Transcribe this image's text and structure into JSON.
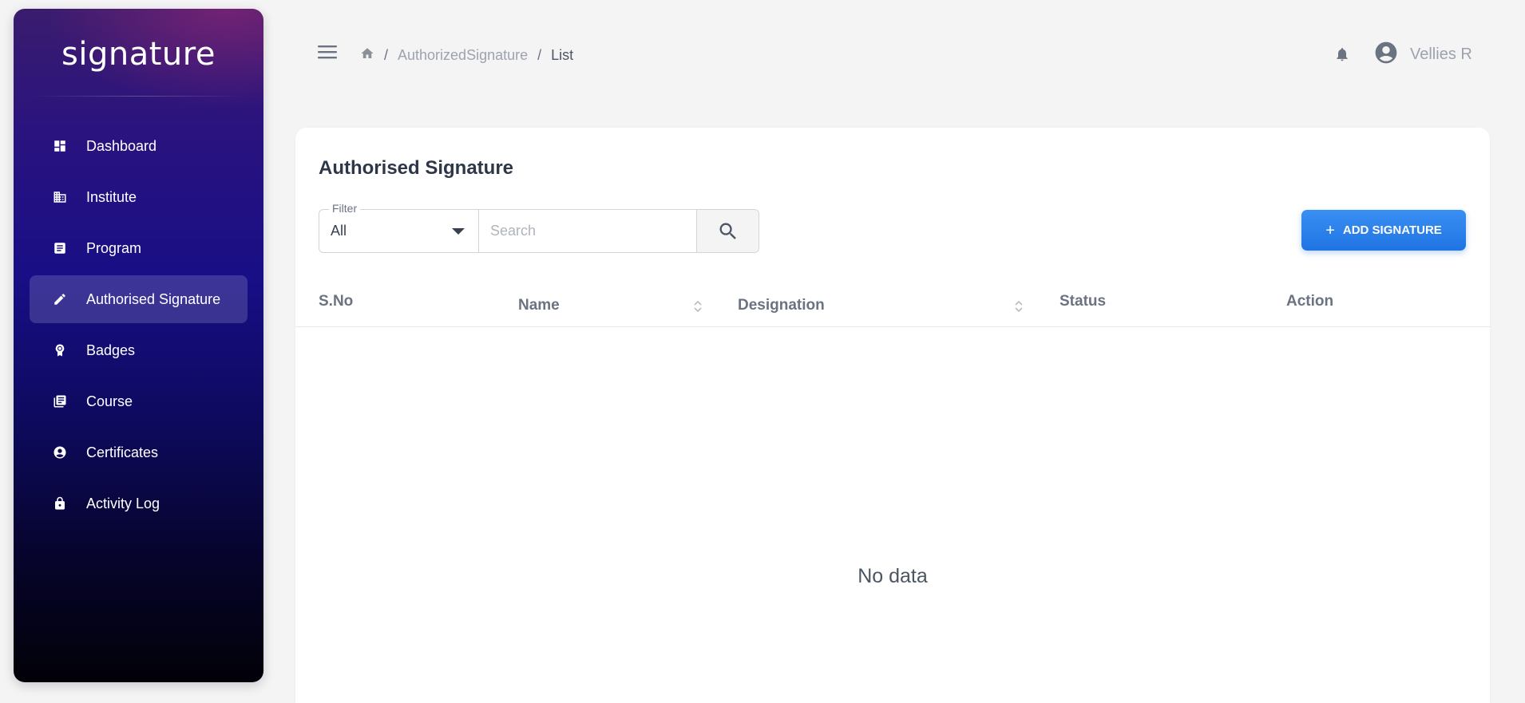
{
  "sidebar": {
    "brand": "signature",
    "items": [
      {
        "label": "Dashboard",
        "icon": "dashboard-icon"
      },
      {
        "label": "Institute",
        "icon": "institute-icon"
      },
      {
        "label": "Program",
        "icon": "program-icon"
      },
      {
        "label": "Authorised Signature",
        "icon": "pencil-icon",
        "active": true
      },
      {
        "label": "Badges",
        "icon": "badge-icon"
      },
      {
        "label": "Course",
        "icon": "course-icon"
      },
      {
        "label": "Certificates",
        "icon": "certificate-icon"
      },
      {
        "label": "Activity Log",
        "icon": "lock-icon"
      }
    ]
  },
  "header": {
    "breadcrumb": {
      "home_icon": "home-icon",
      "separator": "/",
      "link": "AuthorizedSignature",
      "current": "List"
    },
    "notification_icon": "bell-icon",
    "user": {
      "name": "Vellies R",
      "avatar_icon": "account-circle-icon"
    }
  },
  "page": {
    "title": "Authorised Signature",
    "filter": {
      "legend": "Filter",
      "selected": "All"
    },
    "search": {
      "placeholder": "Search",
      "value": ""
    },
    "add_button": {
      "label": "ADD SIGNATURE",
      "plus": "+"
    },
    "table": {
      "columns": [
        {
          "label": "S.No",
          "sortable": false
        },
        {
          "label": "Name",
          "sortable": true
        },
        {
          "label": "Designation",
          "sortable": true
        },
        {
          "label": "Status",
          "sortable": false
        },
        {
          "label": "Action",
          "sortable": false
        }
      ],
      "rows": [],
      "empty_text": "No data"
    }
  },
  "colors": {
    "accent": "#1f74e3",
    "sidebar_top": "#3a1c6e",
    "sidebar_bottom": "#020108",
    "page_bg": "#f4f4f5"
  }
}
